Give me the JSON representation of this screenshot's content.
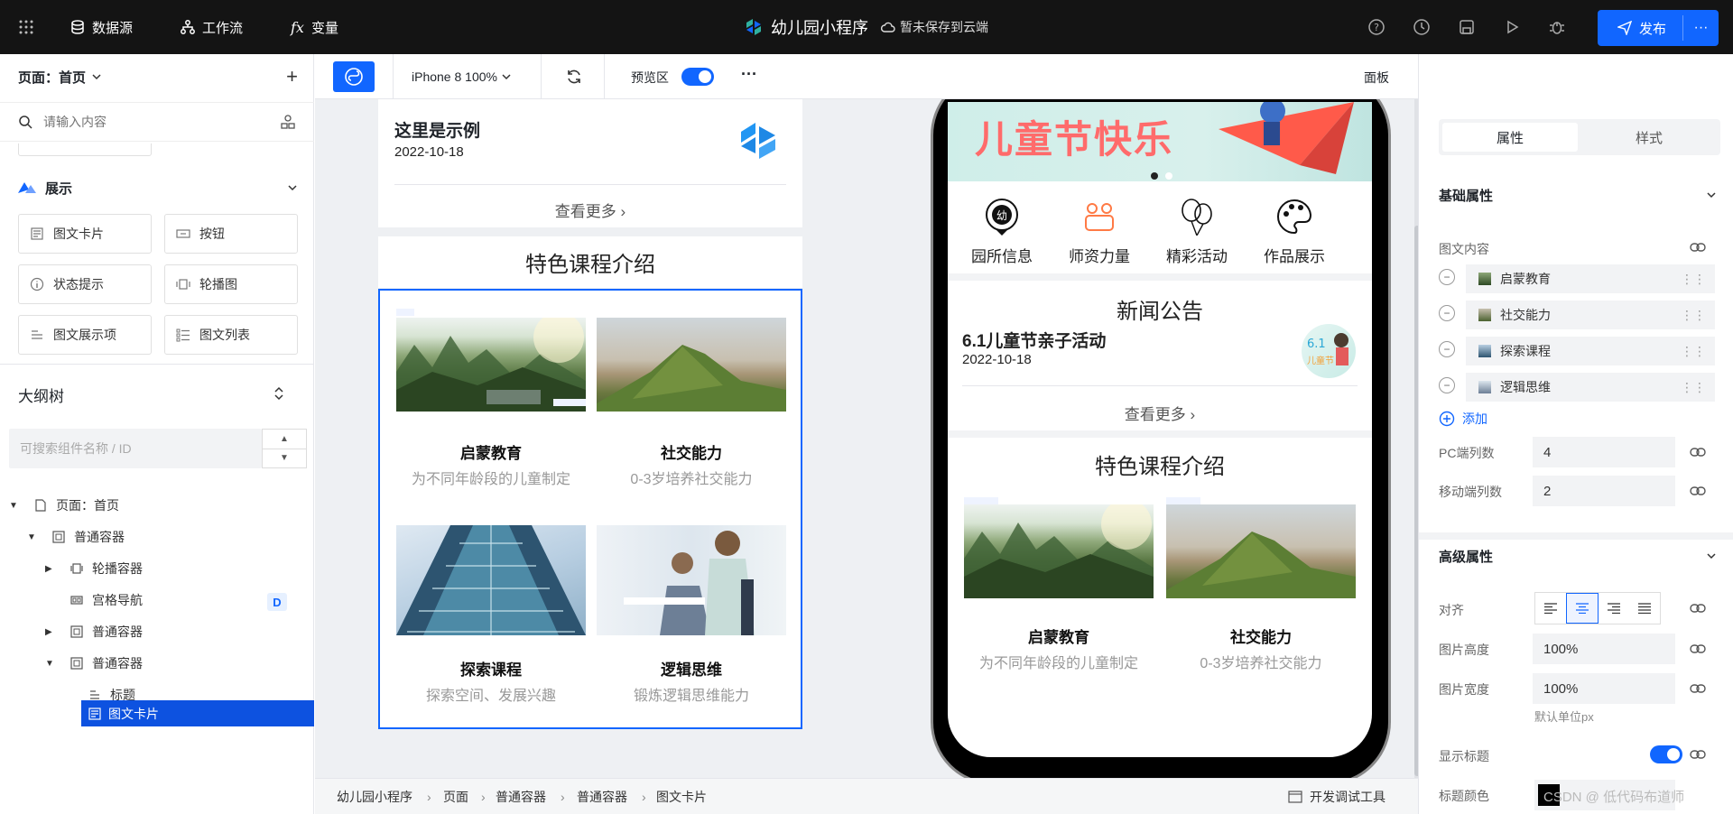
{
  "topbar": {
    "datasource": "数据源",
    "workflow": "工作流",
    "variables": "变量",
    "app_name": "幼儿园小程序",
    "save_status": "暂未保存到云端",
    "publish": "发布"
  },
  "left": {
    "page_selector": "页面：首页",
    "search_placeholder": "请输入内容",
    "section": "展示",
    "components": [
      "图文卡片",
      "按钮",
      "状态提示",
      "轮播图",
      "图文展示项",
      "图文列表"
    ],
    "outline_title": "大纲树",
    "outline_search_placeholder": "可搜索组件名称 / ID",
    "tree": [
      {
        "label": "页面：首页"
      },
      {
        "label": "普通容器"
      },
      {
        "label": "轮播容器"
      },
      {
        "label": "宫格导航",
        "badge": "D"
      },
      {
        "label": "普通容器"
      },
      {
        "label": "普通容器"
      },
      {
        "label": "标题"
      },
      {
        "label": "图文卡片"
      }
    ]
  },
  "canvasbar": {
    "device": "iPhone 8 100%",
    "preview_label": "预览区",
    "preview_on": true,
    "panel": "面板"
  },
  "canvas": {
    "news_title": "这里是示例",
    "news_date": "2022-10-18",
    "see_more": "查看更多",
    "section_title": "特色课程介绍",
    "cards": [
      {
        "title": "启蒙教育",
        "desc": "为不同年龄段的儿童制定"
      },
      {
        "title": "社交能力",
        "desc": "0-3岁培养社交能力"
      },
      {
        "title": "探索课程",
        "desc": "探索空间、发展兴趣"
      },
      {
        "title": "逻辑思维",
        "desc": "锻炼逻辑思维能力"
      }
    ]
  },
  "phone": {
    "banner_text": "儿童节快乐",
    "nav": [
      "园所信息",
      "师资力量",
      "精彩活动",
      "作品展示"
    ],
    "news_header": "新闻公告",
    "news_title": "6.1儿童节亲子活动",
    "news_date": "2022-10-18",
    "see_more": "查看更多",
    "section_title": "特色课程介绍",
    "cards": [
      {
        "title": "启蒙教育",
        "desc": "为不同年龄段的儿童制定"
      },
      {
        "title": "社交能力",
        "desc": "0-3岁培养社交能力"
      }
    ]
  },
  "statusbar": {
    "breadcrumb": [
      "幼儿园小程序",
      "页面",
      "普通容器",
      "普通容器",
      "图文卡片"
    ],
    "devtools": "开发调试工具"
  },
  "right": {
    "tab_props": "属性",
    "tab_style": "样式",
    "basic": "基础属性",
    "content_label": "图文内容",
    "items": [
      "启蒙教育",
      "社交能力",
      "探索课程",
      "逻辑思维"
    ],
    "add": "添加",
    "pc_cols_label": "PC端列数",
    "pc_cols": "4",
    "mobile_cols_label": "移动端列数",
    "mobile_cols": "2",
    "advanced": "高级属性",
    "align_label": "对齐",
    "img_height_label": "图片高度",
    "img_height": "100%",
    "img_width_label": "图片宽度",
    "img_width": "100%",
    "unit_hint": "默认单位px",
    "show_title_label": "显示标题",
    "title_color_label": "标题颜色",
    "watermark": "CSDN @ 低代码布道师"
  }
}
